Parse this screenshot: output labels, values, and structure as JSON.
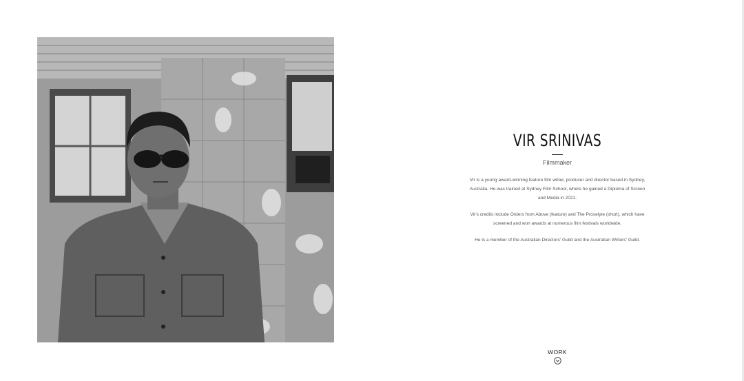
{
  "profile": {
    "name": "VIR SRINIVAS",
    "role": "Filmmaker",
    "paragraphs": [
      "Vir is a young award-winning feature film writer, producer and director based in Sydney, Australia. He was trained at Sydney Film School, where he gained a Diploma of Screen and Media in 2021.",
      "Vir's credits include Orders from Above (feature) and The Proselyte (short), which have screened and won awards at numerous film festivals worldwide.",
      "He is a member of the Australian Directors' Guild and the Australian Writers' Guild."
    ]
  },
  "nav": {
    "work_label": "WORK",
    "work_icon": "chevron-down-circle-icon"
  },
  "photo": {
    "style": "black-and-white portrait"
  }
}
